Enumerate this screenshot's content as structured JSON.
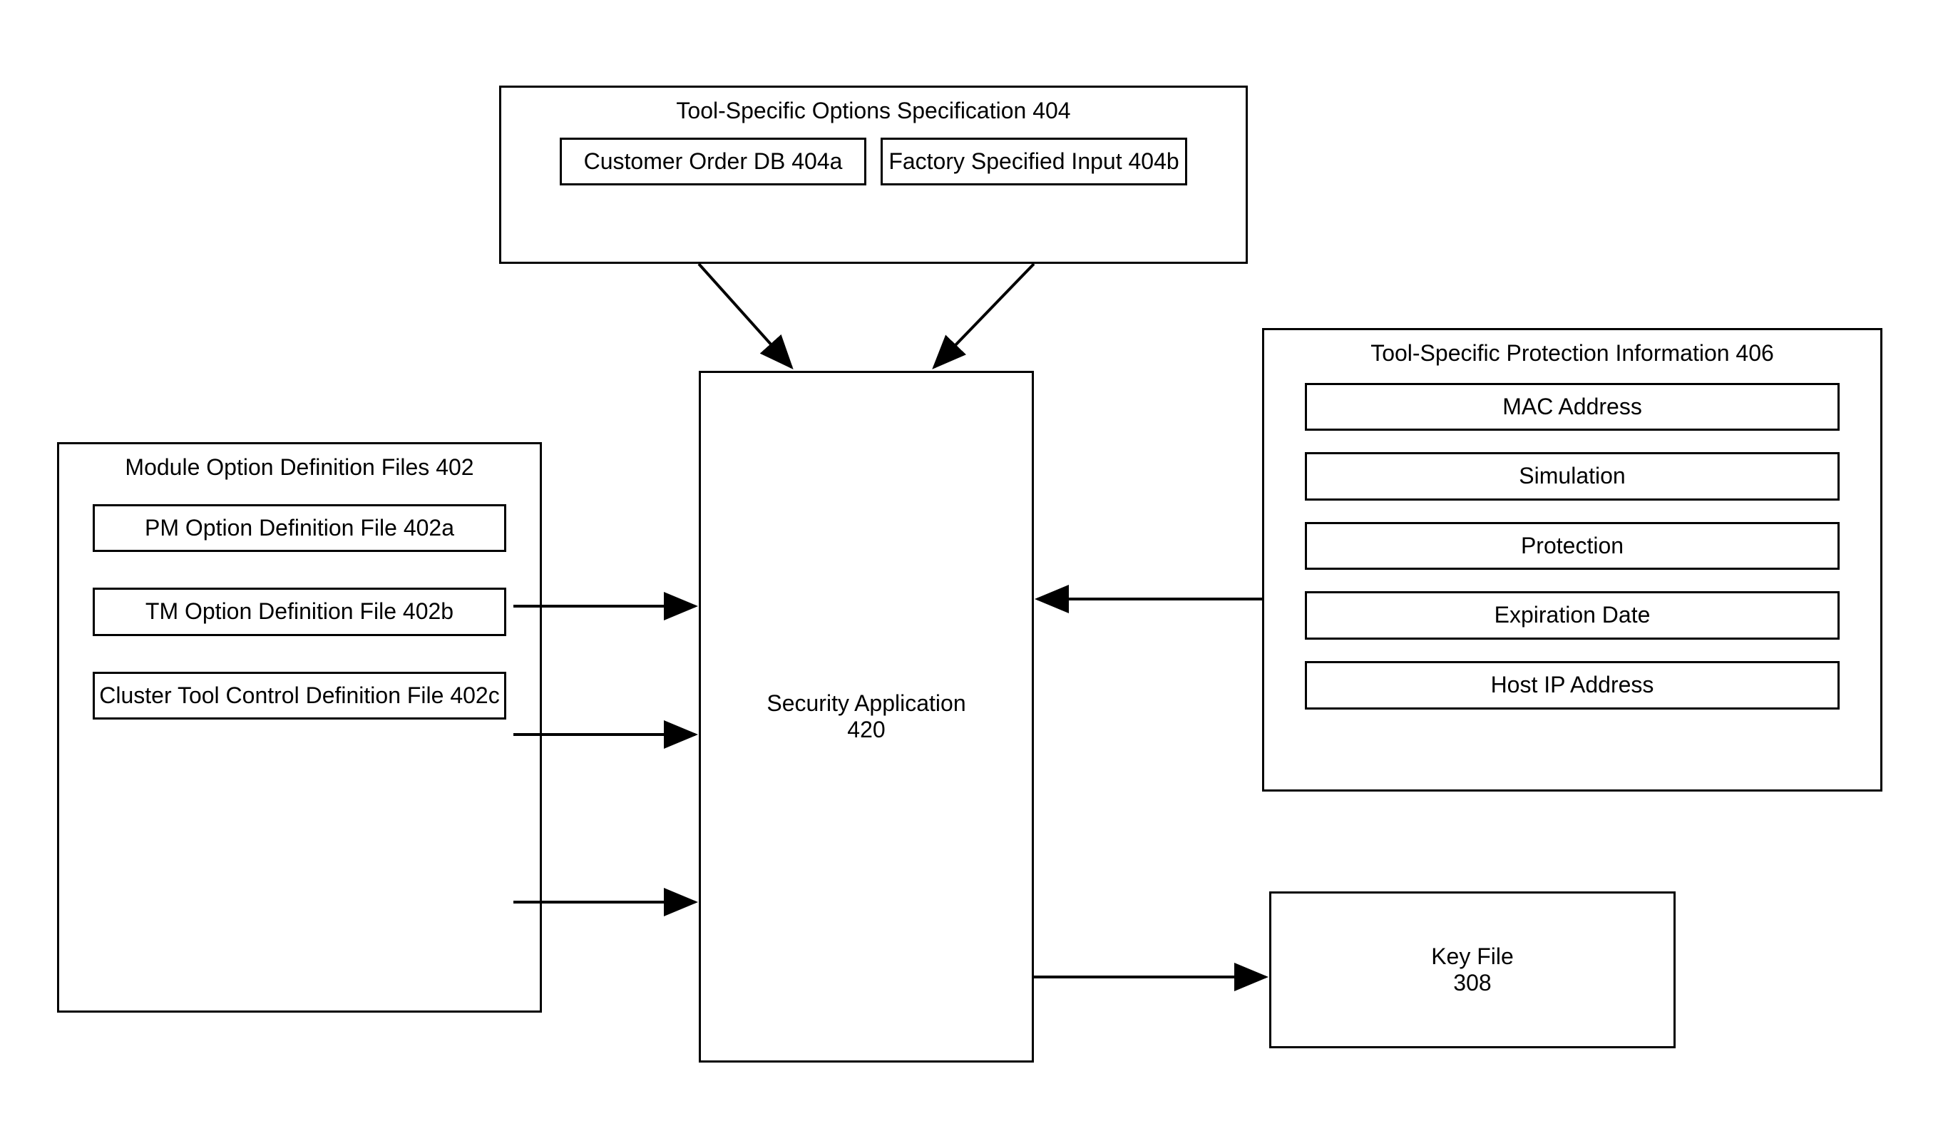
{
  "top_box": {
    "title": "Tool-Specific Options Specification 404",
    "items": [
      "Customer Order DB 404a",
      "Factory Specified Input 404b"
    ]
  },
  "left_box": {
    "title": "Module Option Definition Files 402",
    "items": [
      "PM Option Definition File 402a",
      "TM Option Definition File 402b",
      "Cluster Tool Control Definition File 402c"
    ]
  },
  "center_box": {
    "title": "Security Application",
    "id": "420"
  },
  "right_top_box": {
    "title": "Tool-Specific Protection Information 406",
    "items": [
      "MAC Address",
      "Simulation",
      "Protection",
      "Expiration Date",
      "Host IP Address"
    ]
  },
  "right_bottom_box": {
    "title": "Key File",
    "id": "308"
  }
}
